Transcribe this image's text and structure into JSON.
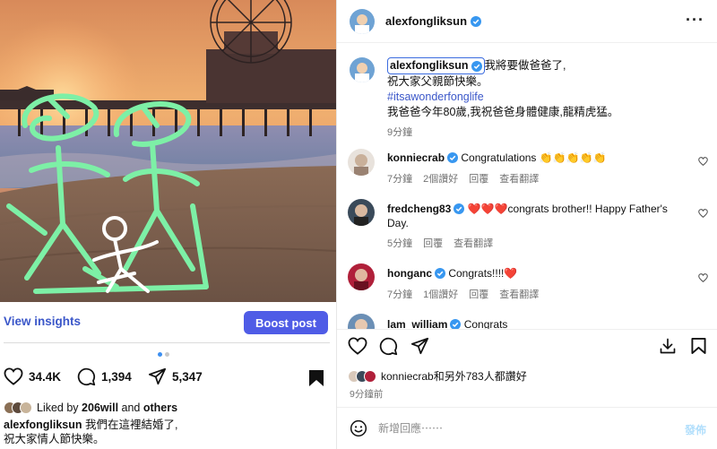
{
  "post": {
    "view_insights": "View insights",
    "boost_post": "Boost post",
    "likes_count": "34.4K",
    "comments_count": "1,394",
    "shares_count": "5,347",
    "liked_by_prefix": "Liked by",
    "liked_by_user": "206will",
    "liked_by_and": "and",
    "liked_by_others": "others",
    "caption_user": "alexfongliksun",
    "caption_line1": "我們在這裡結婚了,",
    "caption_line2": "祝大家情人節快樂。",
    "carousel_total": 2,
    "carousel_active": 0
  },
  "detail": {
    "username": "alexfongliksun",
    "caption_text1": "我將要做爸爸了,",
    "caption_text2": "祝大家父親節快樂。",
    "hashtag": "#itsawonderfonglife",
    "caption_text3": "我爸爸今年80歲,我祝爸爸身體健康,龍精虎猛。",
    "caption_time": "9分鐘",
    "comments": [
      {
        "user": "konniecrab",
        "text": "Congratulations 👏👏👏👏👏",
        "time": "7分鐘",
        "likes": "2個讚好",
        "reply": "回覆",
        "translate": "查看翻譯"
      },
      {
        "user": "fredcheng83",
        "text": "❤️❤️❤️congrats brother!! Happy Father's Day.",
        "time": "5分鐘",
        "reply": "回覆",
        "translate": "查看翻譯"
      },
      {
        "user": "honganc",
        "text": "Congrats!!!!❤️",
        "time": "7分鐘",
        "likes": "1個讚好",
        "reply": "回覆",
        "translate": "查看翻譯"
      },
      {
        "user": "lam_william",
        "text": "Congrats"
      }
    ],
    "liked_summary": "konniecrab和另外783人都讚好",
    "date": "9分鐘前",
    "comment_placeholder": "新增回應⋯⋯",
    "post_button": "發佈"
  },
  "colors": {
    "link_blue": "#3b57c9",
    "boost_bg": "#4f5ce6",
    "heart_red": "#ed4956",
    "doodle_green": "#7df0a6"
  }
}
